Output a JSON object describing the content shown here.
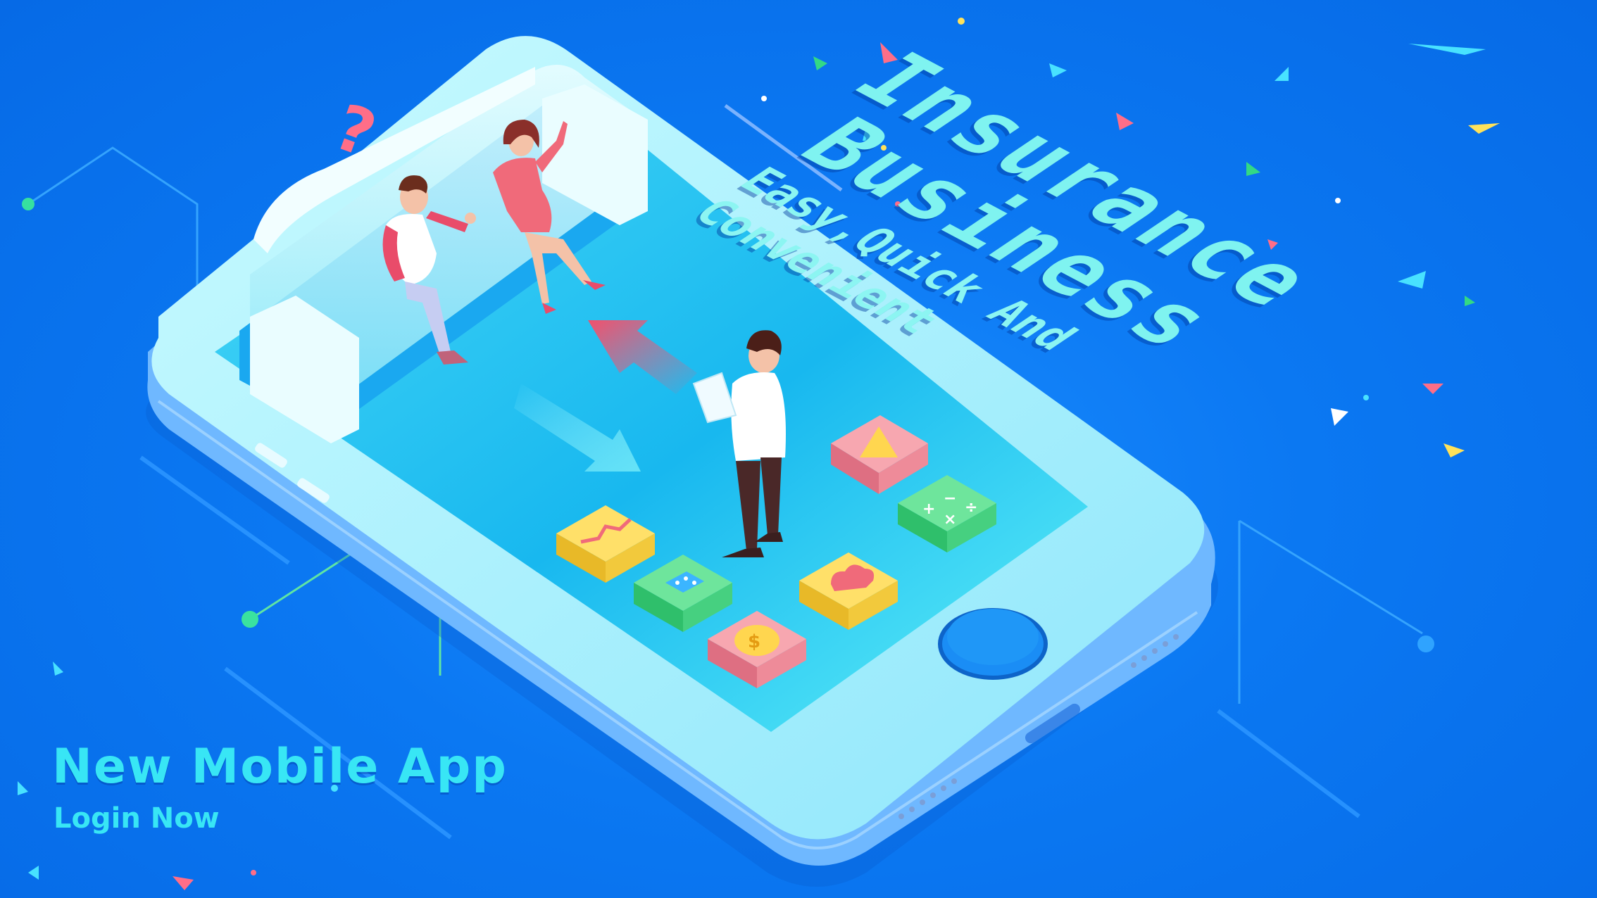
{
  "headline": {
    "line1": "Insurance",
    "line2": "Business",
    "tagline": "Easy,Quick And Convenient"
  },
  "promo": {
    "app_title": "New Mobile App",
    "login_label": "Login Now"
  },
  "icons": [
    "warning-icon",
    "calculator-icon",
    "chart-icon",
    "chat-icon",
    "cloud-icon",
    "dollar-coin-icon"
  ],
  "colors": {
    "background": "#0b78f2",
    "headline": "#7ff3f0",
    "promo_text": "#38e6f5",
    "phone_body": "#aef4ff",
    "screen": "#2fd2f5",
    "accent_red": "#f05a78"
  }
}
